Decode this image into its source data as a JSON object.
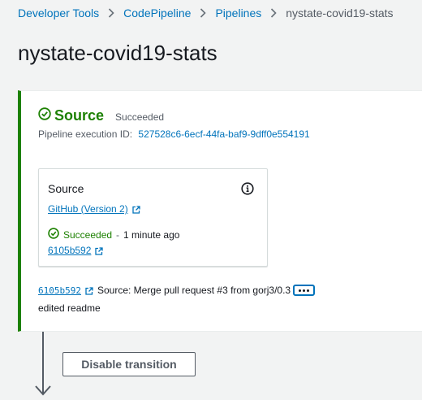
{
  "breadcrumb": {
    "items": [
      "Developer Tools",
      "CodePipeline",
      "Pipelines"
    ],
    "current": "nystate-covid19-stats"
  },
  "page": {
    "title": "nystate-covid19-stats"
  },
  "stage": {
    "name": "Source",
    "status": "Succeeded",
    "execution_label": "Pipeline execution ID:",
    "execution_id": "527528c6-6ecf-44fa-baf9-9dff0e554191",
    "action": {
      "title": "Source",
      "provider": "GitHub (Version 2)",
      "status": "Succeeded",
      "separator": "-",
      "time": "1 minute ago",
      "commit": "6105b592"
    },
    "commit_row": {
      "id": "6105b592",
      "message": "Source: Merge pull request #3 from gorj3/0.3",
      "description": "edited readme"
    }
  },
  "transition": {
    "button_label": "Disable transition"
  },
  "colors": {
    "success": "#1d8102",
    "link": "#0073bb",
    "text": "#16191f",
    "muted": "#545b64"
  },
  "icons": [
    "chevron-right-icon",
    "check-circle-icon",
    "info-icon",
    "external-link-icon",
    "ellipsis-icon",
    "arrow-down-icon"
  ]
}
